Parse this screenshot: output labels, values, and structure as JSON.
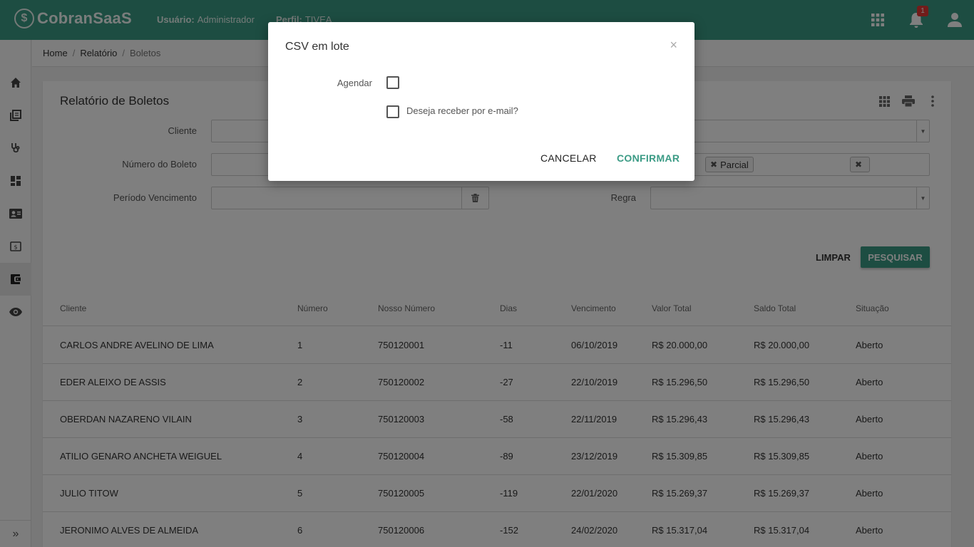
{
  "app": {
    "logo_mark": "$",
    "logo_text": "CobranSaaS"
  },
  "header": {
    "user_label": "Usuário:",
    "user_value": "Administrador",
    "profile_label": "Perfil:",
    "profile_value": "TIVEA",
    "notification_count": "1",
    "icons": [
      "apps-grid-icon",
      "bell-icon",
      "account-icon"
    ]
  },
  "sidebar": {
    "items": [
      "home-icon",
      "library-icon",
      "stethoscope-icon",
      "dashboard-icon",
      "contact-card-icon",
      "money-icon",
      "wallet-icon",
      "eye-icon"
    ],
    "active_index": 6,
    "expand_label": "»"
  },
  "breadcrumb": {
    "items": [
      "Home",
      "Relatório",
      "Boletos"
    ],
    "separator": "/"
  },
  "report": {
    "title": "Relatório de Boletos",
    "tools": [
      "grid-icon",
      "print-icon",
      "more-vert-icon"
    ],
    "filters": {
      "cliente_label": "Cliente",
      "numero_label": "Número do Boleto",
      "periodo_label": "Período Vencimento",
      "regra_label": "Regra",
      "chips": [
        "",
        "Parcial"
      ]
    },
    "buttons": {
      "clear": "LIMPAR",
      "search": "PESQUISAR"
    },
    "columns": [
      "Cliente",
      "Número",
      "Nosso Número",
      "Dias",
      "Vencimento",
      "Valor Total",
      "Saldo Total",
      "Situação"
    ],
    "rows": [
      [
        "CARLOS ANDRE AVELINO DE LIMA",
        "1",
        "750120001",
        "-11",
        "06/10/2019",
        "R$ 20.000,00",
        "R$ 20.000,00",
        "Aberto"
      ],
      [
        "EDER ALEIXO DE ASSIS",
        "2",
        "750120002",
        "-27",
        "22/10/2019",
        "R$ 15.296,50",
        "R$ 15.296,50",
        "Aberto"
      ],
      [
        "OBERDAN NAZARENO VILAIN",
        "3",
        "750120003",
        "-58",
        "22/11/2019",
        "R$ 15.296,43",
        "R$ 15.296,43",
        "Aberto"
      ],
      [
        "ATILIO GENARO ANCHETA WEIGUEL",
        "4",
        "750120004",
        "-89",
        "23/12/2019",
        "R$ 15.309,85",
        "R$ 15.309,85",
        "Aberto"
      ],
      [
        "JULIO TITOW",
        "5",
        "750120005",
        "-119",
        "22/01/2020",
        "R$ 15.269,37",
        "R$ 15.269,37",
        "Aberto"
      ],
      [
        "JERONIMO ALVES DE ALMEIDA",
        "6",
        "750120006",
        "-152",
        "24/02/2020",
        "R$ 15.317,04",
        "R$ 15.317,04",
        "Aberto"
      ]
    ]
  },
  "modal": {
    "title": "CSV em lote",
    "close": "×",
    "schedule_label": "Agendar",
    "email_label": "Deseja receber por e-mail?",
    "schedule_checked": false,
    "email_checked": false,
    "cancel": "CANCELAR",
    "confirm": "CONFIRMAR"
  },
  "colors": {
    "primary": "#3b9b85",
    "badge": "#e53935"
  }
}
